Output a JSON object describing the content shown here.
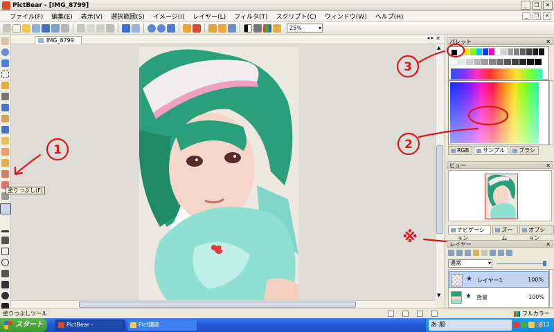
{
  "window": {
    "title": "PictBear - [IMG_8799]"
  },
  "menubar": {
    "items": [
      "ファイル(F)",
      "編集(E)",
      "表示(V)",
      "選択範囲(S)",
      "イメージ(I)",
      "レイヤー(L)",
      "フィルタ(T)",
      "スクリプト(C)",
      "ウィンドウ(W)",
      "ヘルプ(H)"
    ]
  },
  "toolbar": {
    "zoom": "25%"
  },
  "document": {
    "tab": "IMG_8799"
  },
  "tools": {
    "tooltip": "塗りつぶし(F)"
  },
  "panels": {
    "palette": {
      "title": "パレット",
      "tabs": [
        "RGB",
        "サンプル",
        "ブラシ"
      ]
    },
    "view": {
      "title": "ビュー",
      "tabs": [
        "ナビゲーション",
        "ズーム",
        "オプション"
      ]
    },
    "layers": {
      "title": "レイヤー",
      "blend_mode": "通常",
      "items": [
        {
          "name": "レイヤー1",
          "opacity": "100%"
        },
        {
          "name": "背景",
          "opacity": "100%"
        }
      ]
    }
  },
  "statusbar": {
    "left": "塗りつぶしツール",
    "right": "フルカラー"
  },
  "taskbar": {
    "start": "スタート",
    "tasks": [
      "PictBear - [IMG_8799]",
      "Pict講座"
    ],
    "ime": "あ 般",
    "clock": "012"
  },
  "annotations": {
    "marks": [
      "1",
      "2",
      "3",
      "※"
    ]
  },
  "colors": {
    "annotation_red": "#e0141a",
    "selection_blue": "#c3d5f0",
    "taskbar_blue": "#245ad6"
  }
}
